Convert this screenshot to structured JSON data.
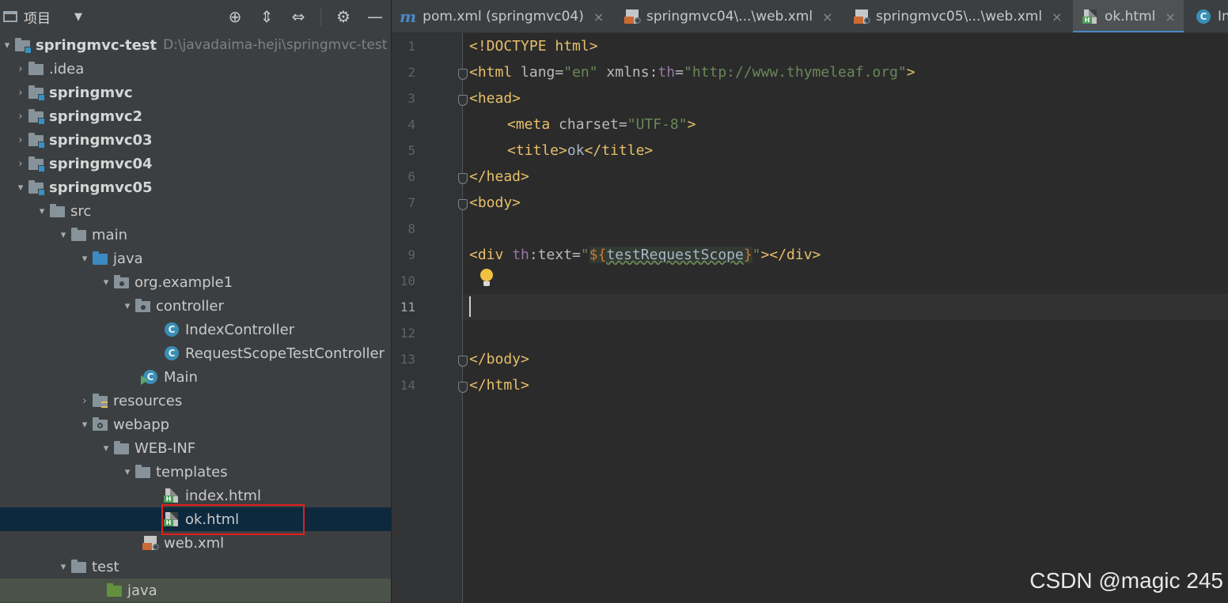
{
  "project_panel": {
    "title": "项目",
    "tools": {
      "locate": "⊕",
      "expand": "⇕",
      "collapse": "⇔",
      "settings": "⚙",
      "hide": "—"
    },
    "tree": [
      {
        "label": "springmvc-test",
        "path": "D:\\javadaima-heji\\springmvc-test",
        "icon": "module-folder-icon",
        "arrow": "▾",
        "bold": true
      },
      {
        "label": ".idea",
        "icon": "folder-icon",
        "arrow": "›"
      },
      {
        "label": "springmvc",
        "icon": "module-folder-icon",
        "arrow": "›",
        "bold": true
      },
      {
        "label": "springmvc2",
        "icon": "module-folder-icon",
        "arrow": "›",
        "bold": true
      },
      {
        "label": "springmvc03",
        "icon": "module-folder-icon",
        "arrow": "›",
        "bold": true
      },
      {
        "label": "springmvc04",
        "icon": "module-folder-icon",
        "arrow": "›",
        "bold": true
      },
      {
        "label": "springmvc05",
        "icon": "module-folder-icon",
        "arrow": "▾",
        "bold": true
      },
      {
        "label": "src",
        "icon": "folder-icon",
        "arrow": "▾"
      },
      {
        "label": "main",
        "icon": "folder-icon",
        "arrow": "▾"
      },
      {
        "label": "java",
        "icon": "source-folder-icon",
        "arrow": "▾"
      },
      {
        "label": "org.example1",
        "icon": "package-icon",
        "arrow": "▾"
      },
      {
        "label": "controller",
        "icon": "package-icon",
        "arrow": "▾"
      },
      {
        "label": "IndexController",
        "icon": "class-icon",
        "arrow": ""
      },
      {
        "label": "RequestScopeTestController",
        "icon": "class-icon",
        "arrow": ""
      },
      {
        "label": "Main",
        "icon": "runnable-class-icon",
        "arrow": ""
      },
      {
        "label": "resources",
        "icon": "resources-folder-icon",
        "arrow": "›"
      },
      {
        "label": "webapp",
        "icon": "web-folder-icon",
        "arrow": "▾"
      },
      {
        "label": "WEB-INF",
        "icon": "folder-icon",
        "arrow": "▾"
      },
      {
        "label": "templates",
        "icon": "folder-icon",
        "arrow": "▾"
      },
      {
        "label": "index.html",
        "icon": "html-file-icon",
        "arrow": ""
      },
      {
        "label": "ok.html",
        "icon": "html-file-icon",
        "arrow": "",
        "selected": true
      },
      {
        "label": "web.xml",
        "icon": "xml-file-icon",
        "arrow": ""
      },
      {
        "label": "test",
        "icon": "folder-icon",
        "arrow": "▾"
      },
      {
        "label": "java",
        "icon": "test-folder-icon",
        "arrow": ""
      }
    ]
  },
  "tabs": [
    {
      "label": "pom.xml (springmvc04)",
      "icon": "maven-icon",
      "close": "×"
    },
    {
      "label": "springmvc04\\...\\web.xml",
      "icon": "xml-file-icon",
      "close": "×"
    },
    {
      "label": "springmvc05\\...\\web.xml",
      "icon": "xml-file-icon",
      "close": "×"
    },
    {
      "label": "ok.html",
      "icon": "html-file-icon",
      "close": "×",
      "active": true
    },
    {
      "label": "In",
      "icon": "class-icon",
      "close": ""
    }
  ],
  "editor": {
    "current_line": 11,
    "line_numbers": [
      "1",
      "2",
      "3",
      "4",
      "5",
      "6",
      "7",
      "8",
      "9",
      "10",
      "11",
      "12",
      "13",
      "14"
    ],
    "code": {
      "l1": {
        "tag": "<!DOCTYPE html>"
      },
      "l2": {
        "open": "<html",
        "attr1": " lang=",
        "val1": "\"en\"",
        "sp": " xmlns",
        "colon": ":",
        "ns": "th",
        "eq": "=",
        "val2": "\"http://www.thymeleaf.org\"",
        "close": ">"
      },
      "l3": {
        "tag": "<head>"
      },
      "l4": {
        "open": "<meta",
        "attr": " charset=",
        "val": "\"UTF-8\"",
        "close": ">"
      },
      "l5": {
        "open": "<title>",
        "text": "ok",
        "close": "</title>"
      },
      "l6": {
        "tag": "</head>"
      },
      "l7": {
        "tag": "<body>"
      },
      "l9": {
        "open": "<div",
        "ns": " th",
        "attr": ":text=",
        "q1": "\"",
        "brace_open": "${",
        "var": "testRequestScope",
        "brace_close": "}",
        "q2": "\"",
        "close": "></div>"
      },
      "l13": {
        "tag": "</body>"
      },
      "l14": {
        "tag": "</html>"
      }
    }
  },
  "watermark": "CSDN @magic 245"
}
